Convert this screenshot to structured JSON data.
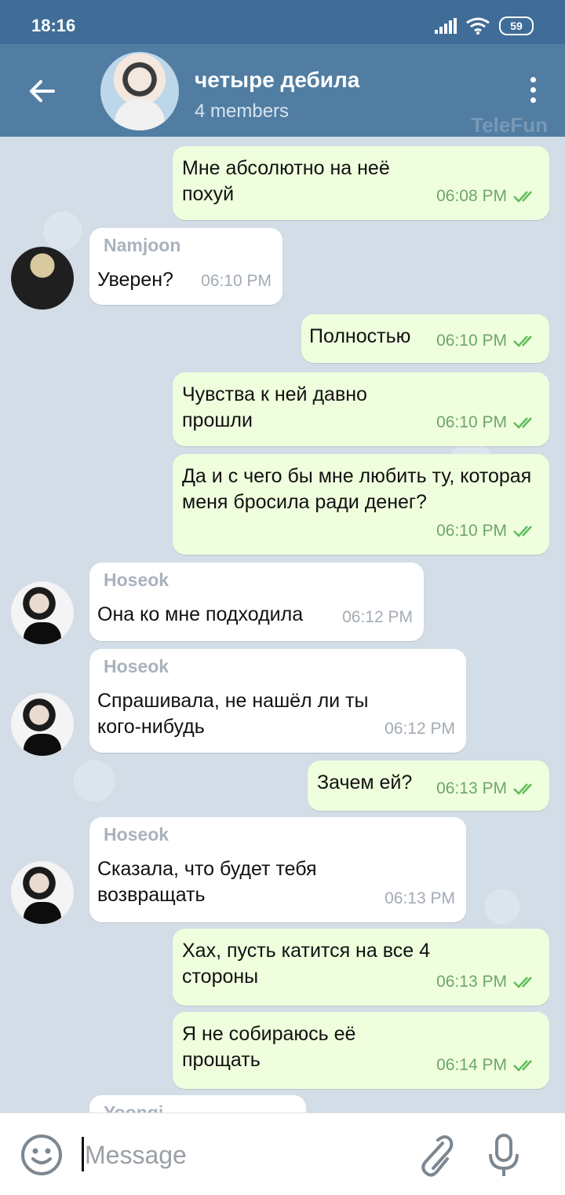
{
  "status_bar": {
    "time": "18:16",
    "battery": "59"
  },
  "header": {
    "title": "четыре дебила",
    "subtitle": "4 members",
    "watermark": "TeleFun"
  },
  "colors": {
    "header": "#517da2",
    "status_bar": "#3f6d98",
    "outgoing_bubble": "#effedd",
    "incoming_bubble": "#ffffff",
    "check": "#5ebd5c"
  },
  "messages": [
    {
      "text": "Мне абсолютно на неё похуй",
      "time": "06:08 PM",
      "outgoing": true
    },
    {
      "sender": "Namjoon",
      "text": "Уверен?",
      "time": "06:10 PM",
      "outgoing": false
    },
    {
      "text": "Полностью",
      "time": "06:10 PM",
      "outgoing": true
    },
    {
      "text": "Чувства к ней давно прошли",
      "time": "06:10 PM",
      "outgoing": true
    },
    {
      "text": "Да и с чего бы мне любить ту, которая меня бросила ради денег?",
      "time": "06:10 PM",
      "outgoing": true
    },
    {
      "sender": "Hoseok",
      "text": "Она ко мне подходила",
      "time": "06:12 PM",
      "outgoing": false
    },
    {
      "sender": "Hoseok",
      "text": "Спрашивала, не нашёл ли ты кого-нибудь",
      "time": "06:12 PM",
      "outgoing": false
    },
    {
      "text": "Зачем ей?",
      "time": "06:13 PM",
      "outgoing": true
    },
    {
      "sender": "Hoseok",
      "text": "Сказала, что будет тебя возвращать",
      "time": "06:13 PM",
      "outgoing": false
    },
    {
      "text": "Хах, пусть катится на все 4 стороны",
      "time": "06:13 PM",
      "outgoing": true
    },
    {
      "text": "Я не собираюсь её прощать",
      "time": "06:14 PM",
      "outgoing": true
    },
    {
      "sender": "Yoongi",
      "text": "",
      "time": "",
      "outgoing": false
    }
  ],
  "composer": {
    "placeholder": "Message"
  },
  "icons": [
    "back-arrow-icon",
    "more-vert-icon",
    "emoji-icon",
    "attach-icon",
    "mic-icon",
    "double-check-icon",
    "signal-icon",
    "wifi-icon",
    "battery-icon"
  ]
}
